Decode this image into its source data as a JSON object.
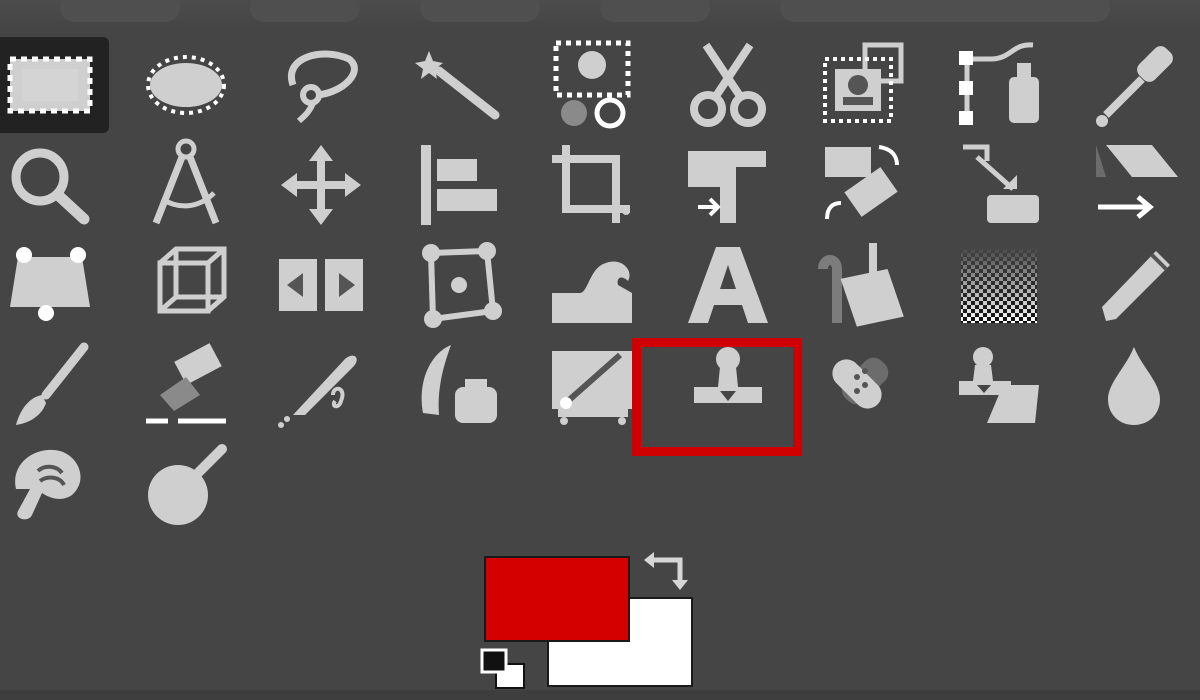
{
  "colors": {
    "background": "#454545",
    "icon": "#cfcfcf",
    "active_tool_bg": "#222222",
    "highlight_border": "#d10000"
  },
  "toolbox": {
    "tools": [
      {
        "icon": "rect-select-icon",
        "active": true
      },
      {
        "icon": "ellipse-select-icon"
      },
      {
        "icon": "free-select-icon"
      },
      {
        "icon": "fuzzy-select-icon"
      },
      {
        "icon": "select-by-color-icon"
      },
      {
        "icon": "scissors-select-icon"
      },
      {
        "icon": "foreground-select-icon"
      },
      {
        "icon": "paths-icon"
      },
      {
        "icon": "color-picker-icon"
      },
      {
        "icon": "zoom-icon"
      },
      {
        "icon": "measure-icon"
      },
      {
        "icon": "move-icon"
      },
      {
        "icon": "align-icon"
      },
      {
        "icon": "crop-icon"
      },
      {
        "icon": "unified-transform-icon"
      },
      {
        "icon": "rotate-icon"
      },
      {
        "icon": "scale-icon"
      },
      {
        "icon": "shear-icon"
      },
      {
        "icon": "perspective-icon"
      },
      {
        "icon": "3d-transform-icon"
      },
      {
        "icon": "flip-icon"
      },
      {
        "icon": "cage-transform-icon"
      },
      {
        "icon": "warp-transform-icon"
      },
      {
        "icon": "text-icon"
      },
      {
        "icon": "bucket-fill-icon"
      },
      {
        "icon": "gradient-icon"
      },
      {
        "icon": "pencil-icon"
      },
      {
        "icon": "paintbrush-icon"
      },
      {
        "icon": "eraser-icon"
      },
      {
        "icon": "airbrush-icon"
      },
      {
        "icon": "ink-icon"
      },
      {
        "icon": "mypaint-brush-icon"
      },
      {
        "icon": "clone-icon",
        "highlighted": true
      },
      {
        "icon": "heal-icon"
      },
      {
        "icon": "perspective-clone-icon"
      },
      {
        "icon": "blur-sharpen-icon"
      },
      {
        "icon": "smudge-icon"
      },
      {
        "icon": "dodge-burn-icon"
      }
    ]
  },
  "color_area": {
    "foreground": "#d40000",
    "background": "#ffffff",
    "swap_icon": "swap-colors-icon",
    "reset_icon": "default-colors-icon"
  }
}
